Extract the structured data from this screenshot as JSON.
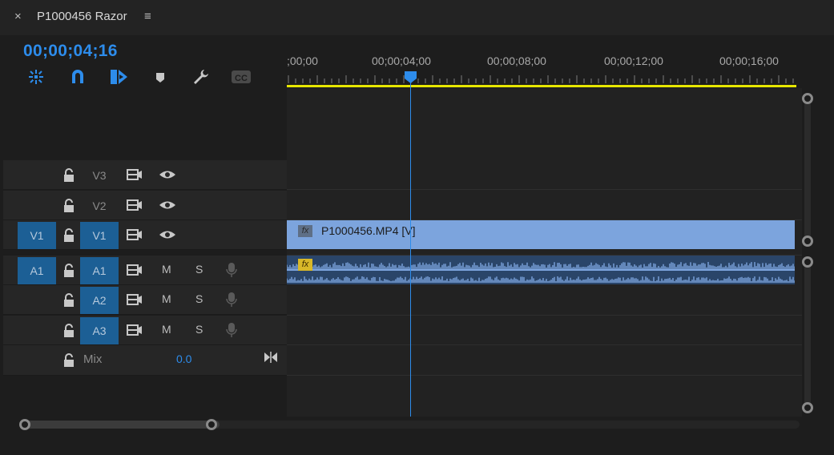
{
  "panel": {
    "close_label": "×",
    "sequence_title": "P1000456 Razor",
    "menu_label": "≡"
  },
  "timecode": "00;00;04;16",
  "toolbar": {
    "icons": [
      "insert-sequence-nest-icon",
      "snap-magnet-icon",
      "linked-selection-icon",
      "add-marker-icon",
      "timeline-settings-wrench-icon",
      "captions-cc-icon"
    ],
    "cc_label": "CC"
  },
  "ruler": {
    "labels": [
      ";00;00",
      "00;00;04;00",
      "00;00;08;00",
      "00;00;12;00",
      "00;00;16;00"
    ]
  },
  "tracks": {
    "video": [
      {
        "target": "V3",
        "source": ""
      },
      {
        "target": "V2",
        "source": ""
      },
      {
        "target": "V1",
        "source": "V1"
      }
    ],
    "audio": [
      {
        "target": "A1",
        "source": "A1",
        "mute": "M",
        "solo": "S"
      },
      {
        "target": "A2",
        "source": "",
        "mute": "M",
        "solo": "S"
      },
      {
        "target": "A3",
        "source": "",
        "mute": "M",
        "solo": "S"
      }
    ],
    "mix": {
      "label": "Mix",
      "value": "0.0"
    }
  },
  "clips": {
    "video_name": "P1000456.MP4 [V]",
    "fx_label": "fx"
  },
  "colors": {
    "accent": "#2d8ceb",
    "video_clip": "#7ca4dd",
    "audio_clip": "#2a4569",
    "work_area": "#e6e600",
    "track_target": "#1c5f95"
  }
}
